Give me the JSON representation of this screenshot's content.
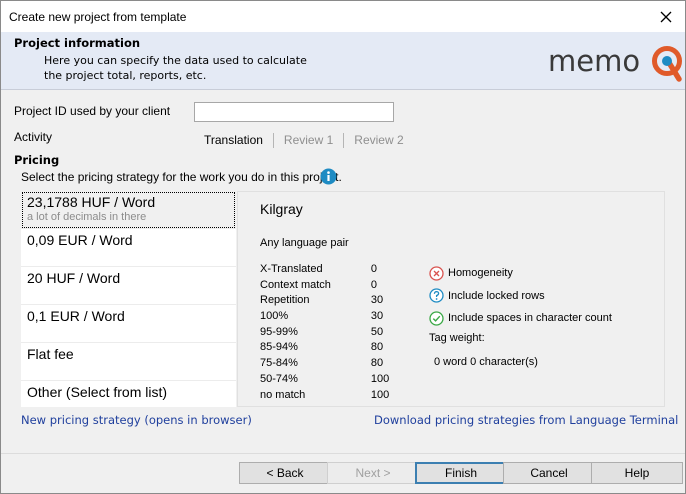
{
  "window": {
    "title": "Create new project from template"
  },
  "header": {
    "title": "Project information",
    "description": "Here you can specify the data used to calculate\nthe project total, reports, etc.",
    "logo_text": "memoQ"
  },
  "form": {
    "project_id_label": "Project ID used by your client",
    "project_id_value": "",
    "activity_label": "Activity",
    "activities": [
      {
        "label": "Translation",
        "active": true
      },
      {
        "label": "Review 1",
        "active": false
      },
      {
        "label": "Review 2",
        "active": false
      }
    ]
  },
  "pricing": {
    "heading": "Pricing",
    "description": "Select the pricing strategy for the work you do in this project.",
    "strategies": [
      {
        "name": "23,1788 HUF / Word",
        "note": "a lot of decimals in there",
        "selected": true
      },
      {
        "name": "0,09 EUR / Word",
        "note": "",
        "selected": false
      },
      {
        "name": "20 HUF / Word",
        "note": "",
        "selected": false
      },
      {
        "name": "0,1 EUR / Word",
        "note": "",
        "selected": false
      },
      {
        "name": "Flat fee",
        "note": "",
        "selected": false
      },
      {
        "name": "Other (Select from list)",
        "note": "",
        "selected": false
      }
    ],
    "detail": {
      "name": "Kilgray",
      "language_pair": "Any language pair",
      "rates": [
        {
          "label": "X-Translated",
          "value": "0"
        },
        {
          "label": "Context match",
          "value": "0"
        },
        {
          "label": "Repetition",
          "value": "30"
        },
        {
          "label": "100%",
          "value": "30"
        },
        {
          "label": "95-99%",
          "value": "50"
        },
        {
          "label": "85-94%",
          "value": "80"
        },
        {
          "label": "75-84%",
          "value": "80"
        },
        {
          "label": "50-74%",
          "value": "100"
        },
        {
          "label": "no match",
          "value": "100"
        }
      ],
      "options": [
        {
          "label": "Homogeneity",
          "icon": "x-circle-icon",
          "color": "#d9534f"
        },
        {
          "label": "Include locked rows",
          "icon": "question-circle-icon",
          "color": "#1e8bc3"
        },
        {
          "label": "Include spaces in character count",
          "icon": "check-circle-icon",
          "color": "#3aa845"
        }
      ],
      "tag_weight_label": "Tag weight:",
      "tag_weight_value": "0 word 0 character(s)"
    },
    "new_link": "New pricing strategy (opens in browser)",
    "download_link": "Download pricing strategies from Language Terminal"
  },
  "buttons": {
    "back": "< Back",
    "next": "Next >",
    "finish": "Finish",
    "cancel": "Cancel",
    "help": "Help"
  },
  "colors": {
    "link": "#1f3f9d",
    "header_bg": "#e4eaf5",
    "logo_accent": "#e05a2a"
  }
}
